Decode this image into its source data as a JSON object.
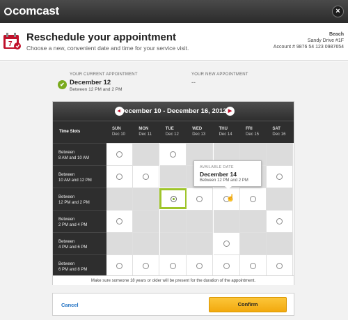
{
  "topbar": {
    "brand": "comcast",
    "close_label": "×"
  },
  "header": {
    "title": "Reschedule your appointment",
    "subtitle": "Choose a new, convenient date and time for your service visit.",
    "calendar_icon_text": "7",
    "account_name": "Beach",
    "account_address": "Sandy Drive #1F",
    "account_number": "Account # 9876 54 123 0987654"
  },
  "current": {
    "label": "YOUR CURRENT APPOINTMENT",
    "date": "December 12",
    "time": "Between 12 PM and 2 PM",
    "check_icon": "✔"
  },
  "new_appt": {
    "label": "YOUR NEW APPOINTMENT",
    "value": "--"
  },
  "calendar": {
    "range": "December 10 - December 16, 2012",
    "prev_icon": "◀",
    "next_icon": "▶",
    "slot_col_title": "Time Slots",
    "days": [
      {
        "name": "SUN",
        "date": "Dec 10"
      },
      {
        "name": "MON",
        "date": "Dec 11"
      },
      {
        "name": "TUE",
        "date": "Dec 12"
      },
      {
        "name": "WED",
        "date": "Dec 13"
      },
      {
        "name": "THU",
        "date": "Dec 14"
      },
      {
        "name": "FRI",
        "date": "Dec 15"
      },
      {
        "name": "SAT",
        "date": "Dec 16"
      }
    ],
    "slots": [
      {
        "line1": "Between",
        "line2": "8 AM and 10 AM",
        "available": [
          true,
          false,
          true,
          false,
          false,
          false,
          false
        ]
      },
      {
        "line1": "Between",
        "line2": "10 AM and 12 PM",
        "available": [
          true,
          true,
          false,
          false,
          true,
          false,
          true
        ]
      },
      {
        "line1": "Between",
        "line2": "12 PM and 2 PM",
        "available": [
          false,
          false,
          true,
          true,
          true,
          true,
          false
        ]
      },
      {
        "line1": "Between",
        "line2": "2 PM and 4 PM",
        "available": [
          true,
          false,
          false,
          false,
          false,
          false,
          true
        ]
      },
      {
        "line1": "Between",
        "line2": "4 PM and 6 PM",
        "available": [
          false,
          false,
          false,
          false,
          true,
          false,
          false
        ]
      },
      {
        "line1": "Between",
        "line2": "6 PM and 8 PM",
        "available": [
          true,
          true,
          true,
          true,
          true,
          true,
          true
        ]
      }
    ],
    "selected": {
      "slot": 2,
      "day": 2
    },
    "note": "Make sure someone 18 years or older will be present for the duration of the appointment."
  },
  "tooltip": {
    "label": "AVAILABLE DATE",
    "date": "December 14",
    "time": "Between 12 PM and 2 PM"
  },
  "footer": {
    "cancel_label": "Cancel",
    "confirm_label": "Confirm"
  },
  "colors": {
    "brand_red": "#c0102a",
    "accent_green": "#7aab1e",
    "confirm_yellow": "#f2a90e",
    "link_blue": "#1d6fc2"
  }
}
